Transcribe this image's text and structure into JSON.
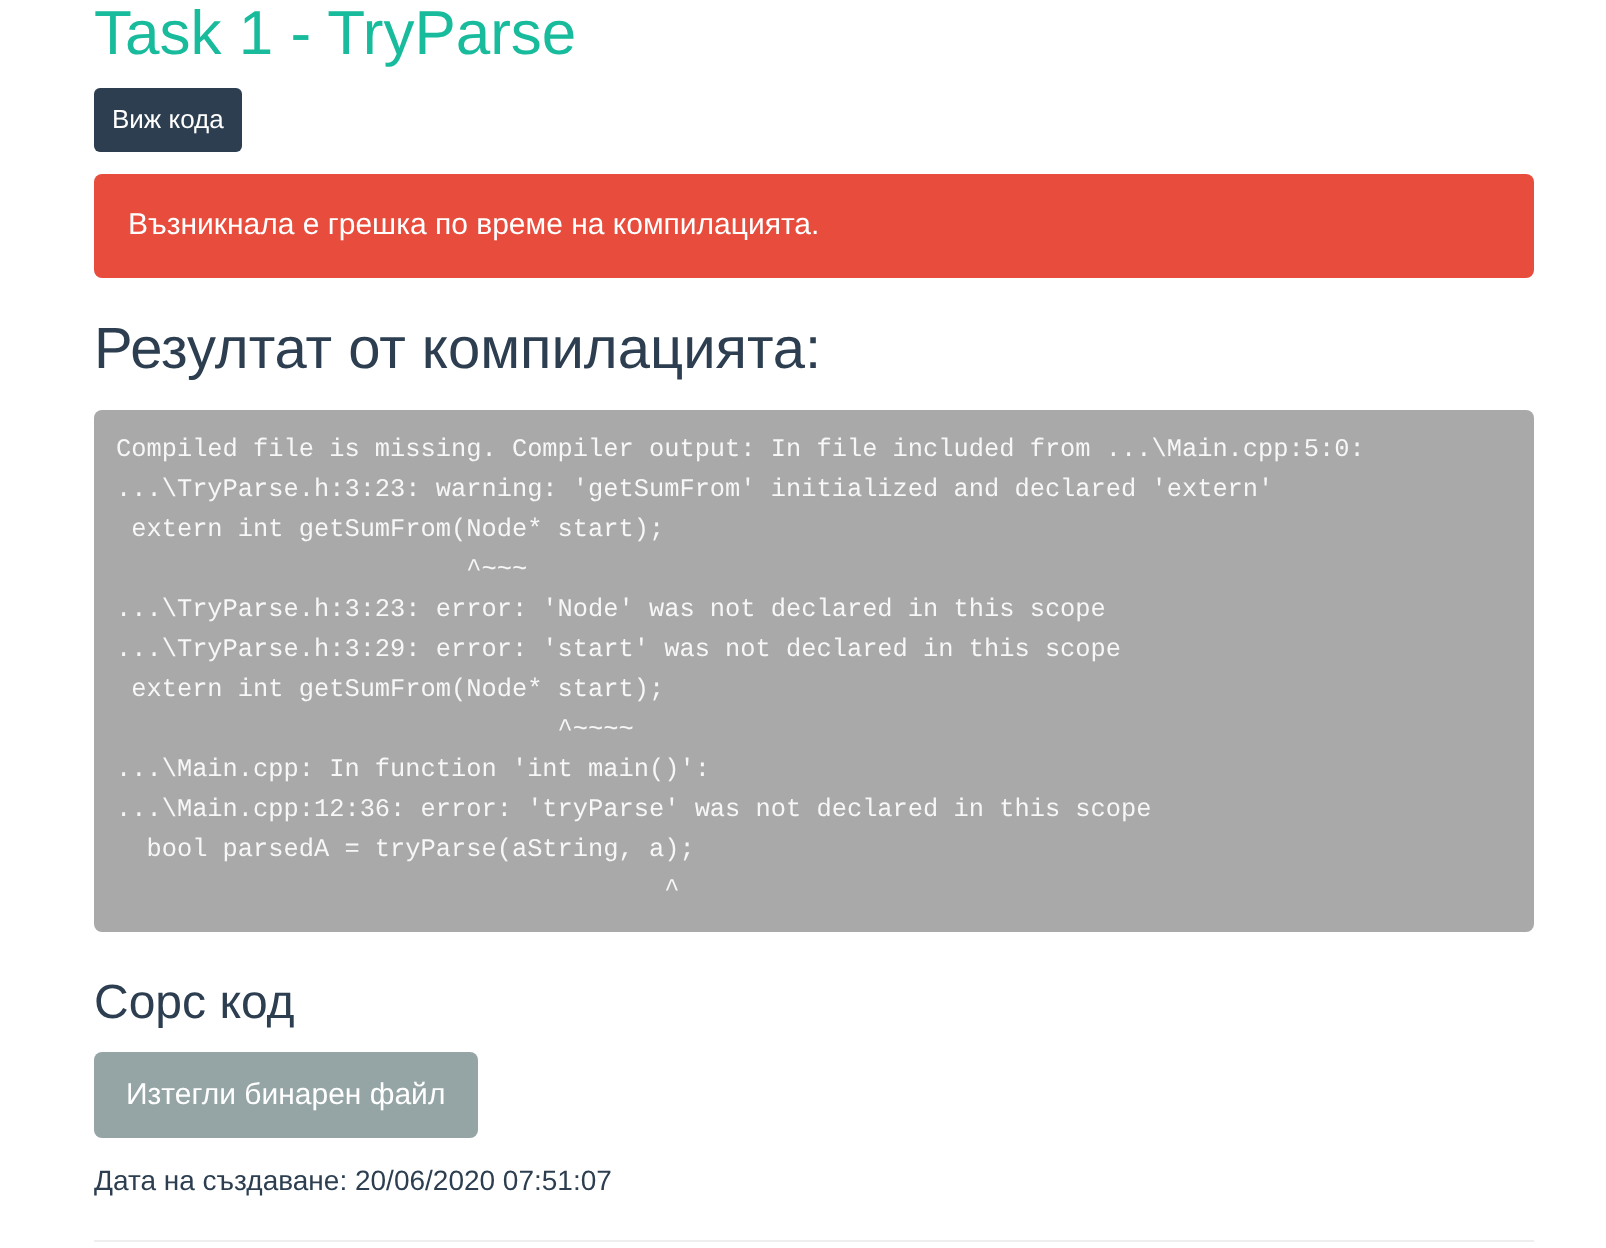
{
  "page_title": "Task 1 - TryParse",
  "view_code_button": "Виж кода",
  "alert": {
    "kind": "danger",
    "message": "Възникнала е грешка по време на компилацията."
  },
  "compilation": {
    "heading": "Резултат от компилацията:",
    "output_lines": [
      "Compiled file is missing. Compiler output: In file included from ...\\Main.cpp:5:0:",
      "...\\TryParse.h:3:23: warning: 'getSumFrom' initialized and declared 'extern'",
      " extern int getSumFrom(Node* start);",
      "                       ^~~~",
      "...\\TryParse.h:3:23: error: 'Node' was not declared in this scope",
      "...\\TryParse.h:3:29: error: 'start' was not declared in this scope",
      " extern int getSumFrom(Node* start);",
      "                             ^~~~~",
      "...\\Main.cpp: In function 'int main()':",
      "...\\Main.cpp:12:36: error: 'tryParse' was not declared in this scope",
      "  bool parsedA = tryParse(aString, a);",
      "                                    ^"
    ]
  },
  "source": {
    "heading": "Сорс код",
    "download_button": "Изтегли бинарен файл",
    "created": "Дата на създаване: 20/06/2020 07:51:07"
  }
}
